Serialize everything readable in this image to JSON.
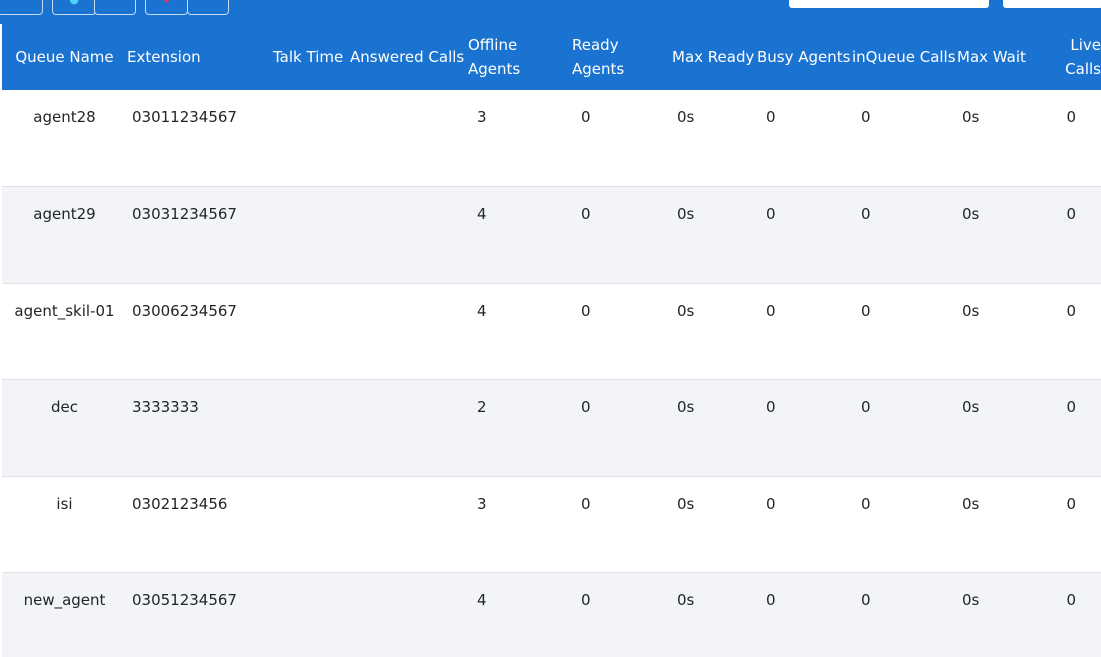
{
  "table": {
    "headers": {
      "queue_name": "Queue Name",
      "extension": "Extension",
      "talk_time": "Talk Time",
      "answered_calls": "Answered Calls",
      "offline_agents": "Offline Agents",
      "ready_agents": "Ready Agents",
      "max_ready": "Max Ready",
      "busy_agents": "Busy Agents",
      "inqueue_calls": "inQueue Calls",
      "max_wait": "Max Wait",
      "live_calls": "Live Calls"
    },
    "rows": [
      {
        "queue_name": "agent28",
        "extension": "03011234567",
        "talk_time": "",
        "answered_calls": "",
        "offline_agents": "3",
        "ready_agents": "0",
        "max_ready": "0s",
        "busy_agents": "0",
        "inqueue_calls": "0",
        "max_wait": "0s",
        "live_calls": "0"
      },
      {
        "queue_name": "agent29",
        "extension": "03031234567",
        "talk_time": "",
        "answered_calls": "",
        "offline_agents": "4",
        "ready_agents": "0",
        "max_ready": "0s",
        "busy_agents": "0",
        "inqueue_calls": "0",
        "max_wait": "0s",
        "live_calls": "0"
      },
      {
        "queue_name": "agent_skil-01",
        "extension": "03006234567",
        "talk_time": "",
        "answered_calls": "",
        "offline_agents": "4",
        "ready_agents": "0",
        "max_ready": "0s",
        "busy_agents": "0",
        "inqueue_calls": "0",
        "max_wait": "0s",
        "live_calls": "0"
      },
      {
        "queue_name": "dec",
        "extension": "3333333",
        "talk_time": "",
        "answered_calls": "",
        "offline_agents": "2",
        "ready_agents": "0",
        "max_ready": "0s",
        "busy_agents": "0",
        "inqueue_calls": "0",
        "max_wait": "0s",
        "live_calls": "0"
      },
      {
        "queue_name": "isi",
        "extension": "0302123456",
        "talk_time": "",
        "answered_calls": "",
        "offline_agents": "3",
        "ready_agents": "0",
        "max_ready": "0s",
        "busy_agents": "0",
        "inqueue_calls": "0",
        "max_wait": "0s",
        "live_calls": "0"
      },
      {
        "queue_name": "new_agent",
        "extension": "03051234567",
        "talk_time": "",
        "answered_calls": "",
        "offline_agents": "4",
        "ready_agents": "0",
        "max_ready": "0s",
        "busy_agents": "0",
        "inqueue_calls": "0",
        "max_wait": "0s",
        "live_calls": "0"
      }
    ]
  },
  "colors": {
    "header_bg": "#1a73d1",
    "header_text": "#ffffff",
    "row_alt_bg": "#f2f4f7"
  },
  "icons": {
    "toolbar_refresh": "refresh-icon",
    "toolbar_alert": "alert-icon"
  }
}
